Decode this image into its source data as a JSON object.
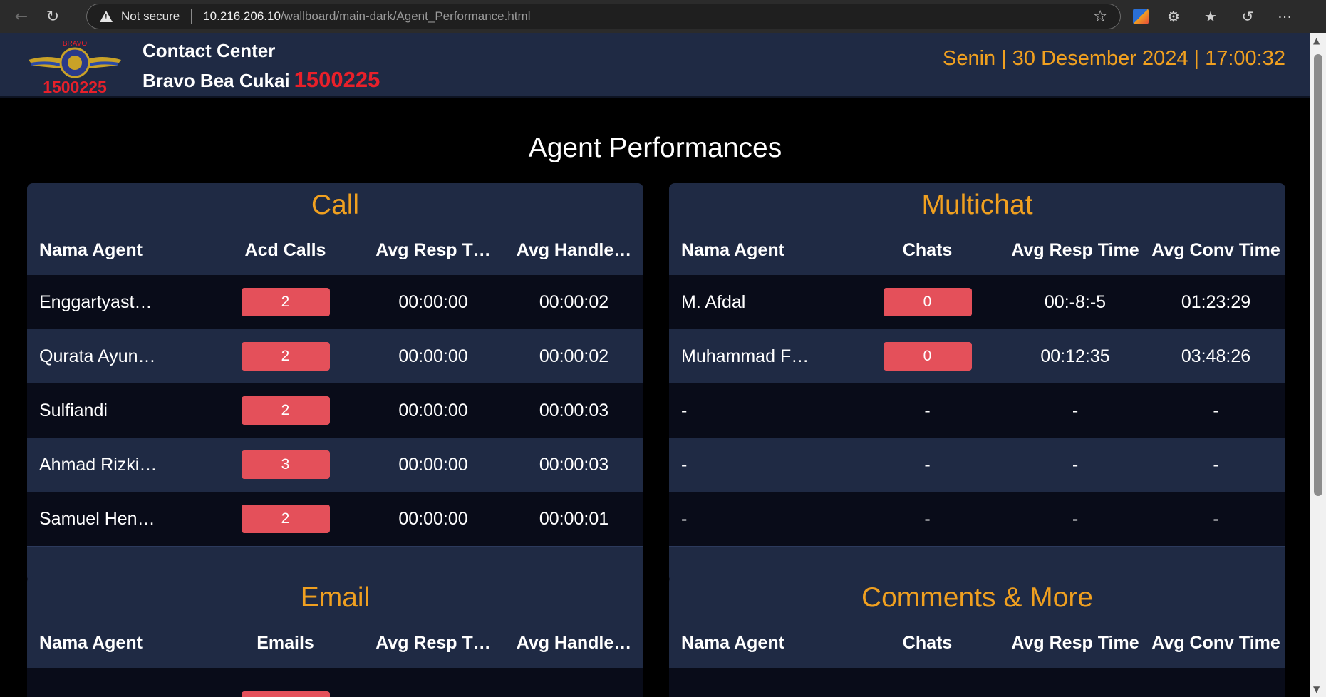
{
  "browser": {
    "security_label": "Not secure",
    "url_host": "10.216.206.10",
    "url_path": "/wallboard/main-dark/Agent_Performance.html"
  },
  "header": {
    "logo_top_text": "BRAVO",
    "logo_number": "1500225",
    "brand_line1": "Contact Center",
    "brand_line2": "Bravo Bea Cukai",
    "brand_number": "1500225",
    "datetime": "Senin | 30 Desember 2024 | 17:00:32"
  },
  "page_title": "Agent Performances",
  "colors": {
    "accent": "#f0a020",
    "badge": "#e4505a",
    "panel": "#1f2a44",
    "row_dark": "#090c19",
    "brand_red": "#e8202a"
  },
  "call": {
    "title": "Call",
    "columns": [
      "Nama Agent",
      "Acd Calls",
      "Avg Resp T…",
      "Avg Handle…"
    ],
    "rows": [
      {
        "agent": "Enggartyast…",
        "count": "2",
        "resp": "00:00:00",
        "handle": "00:00:02"
      },
      {
        "agent": "Qurata Ayun…",
        "count": "2",
        "resp": "00:00:00",
        "handle": "00:00:02"
      },
      {
        "agent": "Sulfiandi",
        "count": "2",
        "resp": "00:00:00",
        "handle": "00:00:03"
      },
      {
        "agent": "Ahmad Rizki…",
        "count": "3",
        "resp": "00:00:00",
        "handle": "00:00:03"
      },
      {
        "agent": "Samuel Hen…",
        "count": "2",
        "resp": "00:00:00",
        "handle": "00:00:01"
      }
    ]
  },
  "multichat": {
    "title": "Multichat",
    "columns": [
      "Nama Agent",
      "Chats",
      "Avg Resp Time",
      "Avg Conv Time"
    ],
    "rows": [
      {
        "agent": "M. Afdal",
        "count": "0",
        "resp": "00:-8:-5",
        "conv": "01:23:29"
      },
      {
        "agent": "Muhammad F…",
        "count": "0",
        "resp": "00:12:35",
        "conv": "03:48:26"
      },
      {
        "agent": "-",
        "count": "-",
        "resp": "-",
        "conv": "-"
      },
      {
        "agent": "-",
        "count": "-",
        "resp": "-",
        "conv": "-"
      },
      {
        "agent": "-",
        "count": "-",
        "resp": "-",
        "conv": "-"
      }
    ]
  },
  "email": {
    "title": "Email",
    "columns": [
      "Nama Agent",
      "Emails",
      "Avg Resp T…",
      "Avg Handle…"
    ]
  },
  "comments": {
    "title": "Comments & More",
    "columns": [
      "Nama Agent",
      "Chats",
      "Avg Resp Time",
      "Avg Conv Time"
    ]
  }
}
